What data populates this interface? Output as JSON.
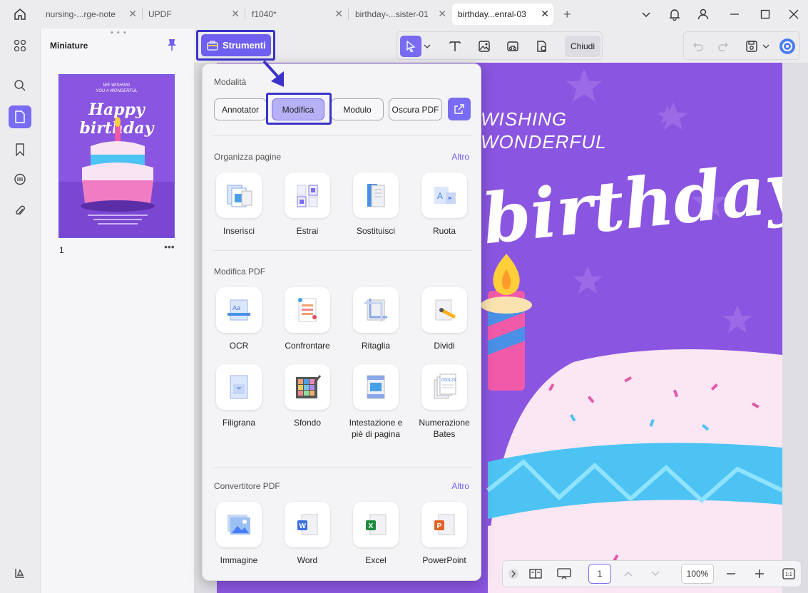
{
  "tabs": [
    {
      "label": "nursing-...rge-note",
      "active": false
    },
    {
      "label": "UPDF",
      "active": false
    },
    {
      "label": "f1040*",
      "active": false
    },
    {
      "label": "birthday-...sister-01",
      "active": false
    },
    {
      "label": "birthday...enral-03",
      "active": true
    }
  ],
  "thumbnails": {
    "title": "Miniature",
    "page_number": "1",
    "thumb_line1": "WE WISHING",
    "thumb_line2": "YOU A WONDERFUL",
    "thumb_title": "Happy birthday"
  },
  "toolbar": {
    "strumenti_label": "Strumenti",
    "chiudi_label": "Chiudi"
  },
  "popup": {
    "modalita_title": "Modalità",
    "modes": [
      "Annotator",
      "Modifica",
      "Modulo",
      "Oscura PDF"
    ],
    "active_mode": "Modifica",
    "organizza_title": "Organizza pagine",
    "altro_label": "Altro",
    "organizza_tools": [
      "Inserisci",
      "Estrai",
      "Sostituisci",
      "Ruota"
    ],
    "modifica_title": "Modifica PDF",
    "modifica_tools_row1": [
      "OCR",
      "Confrontare",
      "Ritaglia",
      "Dividi"
    ],
    "modifica_tools_row2": [
      "Filigrana",
      "Sfondo",
      "Intestazione e piè di pagina",
      "Numerazione Bates"
    ],
    "convertitore_title": "Convertitore PDF",
    "convertitore_tools": [
      "Immagine",
      "Word",
      "Excel",
      "PowerPoint"
    ]
  },
  "document": {
    "line1": "WISHING",
    "line2": "WONDERFUL",
    "title_word": "birthday"
  },
  "navbar": {
    "page": "1",
    "zoom": "100%"
  },
  "colors": {
    "accent": "#6e5ff0",
    "page_bg": "#8a55e0",
    "highlight": "#3b33c9"
  }
}
